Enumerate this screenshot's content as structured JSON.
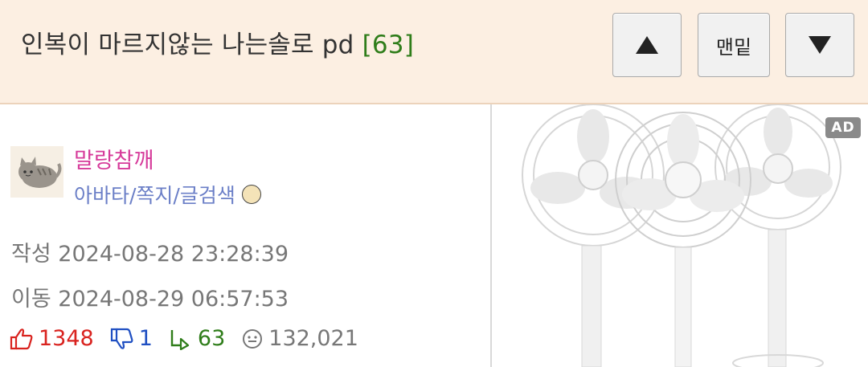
{
  "header": {
    "title": "인복이 마르지않는 나는솔로 pd",
    "reply_count": "[63]",
    "btn_up_label": "▲",
    "btn_bottom_label": "맨밑",
    "btn_down_label": "▼"
  },
  "author": {
    "nickname": "말랑참깨",
    "links": "아바타/쪽지/글검색"
  },
  "meta": {
    "created_label": "작성",
    "created": "2024-08-28 23:28:39",
    "moved_label": "이동",
    "moved": "2024-08-29 06:57:53"
  },
  "stats": {
    "upvotes": "1348",
    "downvotes": "1",
    "replies": "63",
    "views": "132,021"
  },
  "ad": {
    "badge": "AD"
  },
  "colors": {
    "header_bg": "#fcefe2",
    "reply_count": "#2f7d1a",
    "nickname": "#d63a9a",
    "links": "#6b7fc7",
    "upvote": "#d9231f",
    "downvote": "#1f4fc2"
  }
}
